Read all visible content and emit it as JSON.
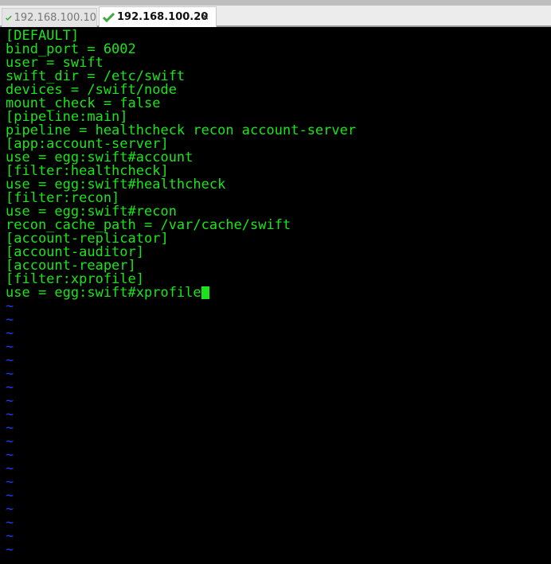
{
  "tabs": [
    {
      "label": "192.168.100.10",
      "active": false,
      "icon": "check-icon"
    },
    {
      "label": "192.168.100.20",
      "active": true,
      "icon": "check-icon",
      "close": "×"
    }
  ],
  "colors": {
    "text": "#19e619",
    "tilde": "#1a3cf0",
    "background": "#000000"
  },
  "editor": {
    "lines": [
      "[DEFAULT]",
      "bind_port = 6002",
      "user = swift",
      "swift_dir = /etc/swift",
      "devices = /swift/node",
      "mount_check = false",
      "[pipeline:main]",
      "pipeline = healthcheck recon account-server",
      "[app:account-server]",
      "use = egg:swift#account",
      "[filter:healthcheck]",
      "use = egg:swift#healthcheck",
      "[filter:recon]",
      "use = egg:swift#recon",
      "recon_cache_path = /var/cache/swift",
      "[account-replicator]",
      "[account-auditor]",
      "[account-reaper]",
      "[filter:xprofile]",
      "use = egg:swift#xprofile"
    ],
    "empty_marker": "~",
    "empty_line_count": 19
  }
}
